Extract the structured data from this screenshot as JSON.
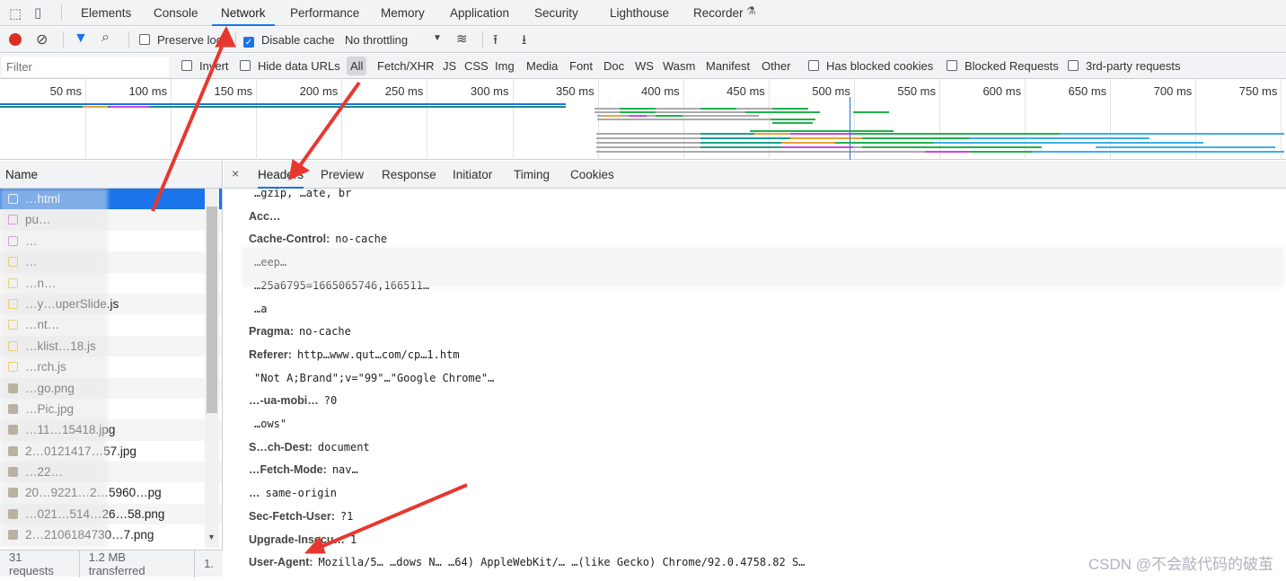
{
  "devtools_tabs": [
    "Elements",
    "Console",
    "Network",
    "Performance",
    "Memory",
    "Application",
    "Security",
    "Lighthouse",
    "Recorder"
  ],
  "active_tab": "Network",
  "toolbar": {
    "preserve_log": "Preserve log",
    "disable_cache": "Disable cache",
    "disable_cache_checked": true,
    "throttling": "No throttling"
  },
  "filterbar": {
    "placeholder": "Filter",
    "invert": "Invert",
    "hide_data_urls": "Hide data URLs",
    "types": [
      "All",
      "Fetch/XHR",
      "JS",
      "CSS",
      "Img",
      "Media",
      "Font",
      "Doc",
      "WS",
      "Wasm",
      "Manifest",
      "Other"
    ],
    "active_type": "All",
    "blocked_cookies": "Has blocked cookies",
    "blocked_requests": "Blocked Requests",
    "third_party": "3rd-party requests"
  },
  "overview": {
    "ticks": [
      "50 ms",
      "100 ms",
      "150 ms",
      "200 ms",
      "250 ms",
      "300 ms",
      "350 ms",
      "400 ms",
      "450 ms",
      "500 ms",
      "550 ms",
      "600 ms",
      "650 ms",
      "700 ms",
      "750 ms"
    ]
  },
  "requests": {
    "header": "Name",
    "items": [
      {
        "name": "…html",
        "type": "doc"
      },
      {
        "name": "pu…",
        "type": "css"
      },
      {
        "name": "…",
        "type": "css"
      },
      {
        "name": "…",
        "type": "js"
      },
      {
        "name": "…n…",
        "type": "js"
      },
      {
        "name": "…y…uperSlide.js",
        "type": "js"
      },
      {
        "name": "…nt…",
        "type": "js"
      },
      {
        "name": "…klist…18.js",
        "type": "js"
      },
      {
        "name": "…rch.js",
        "type": "js"
      },
      {
        "name": "…go.png",
        "type": "img"
      },
      {
        "name": "…Pic.jpg",
        "type": "img"
      },
      {
        "name": "…11…15418.jpg",
        "type": "img"
      },
      {
        "name": "2…0121417…57.jpg",
        "type": "img"
      },
      {
        "name": "…22…",
        "type": "img"
      },
      {
        "name": "20…9221…2…5960…pg",
        "type": "img"
      },
      {
        "name": "…021…514…26…58.png",
        "type": "img"
      },
      {
        "name": "2…2106184730…7.png",
        "type": "img"
      }
    ]
  },
  "status": {
    "requests": "31 requests",
    "transferred": "1.2 MB transferred",
    "resources": "1."
  },
  "detail_tabs": [
    "Headers",
    "Preview",
    "Response",
    "Initiator",
    "Timing",
    "Cookies"
  ],
  "active_detail_tab": "Headers",
  "headers": [
    {
      "k": "",
      "v": "…gzip, …ate, br"
    },
    {
      "k": "Acc…",
      "v": ""
    },
    {
      "k": "Cache-Control:",
      "v": "no-cache"
    },
    {
      "k": "",
      "v": "…eep…"
    },
    {
      "k": "",
      "v": "…25a6795=1665065746,166511…"
    },
    {
      "k": "",
      "v": "…a"
    },
    {
      "k": "Pragma:",
      "v": "no-cache"
    },
    {
      "k": "Referer:",
      "v": "http…www.qut…com/cp…1.htm"
    },
    {
      "k": "",
      "v": "\"Not A;Brand\";v=\"99\"…\"Google Chrome\"…"
    },
    {
      "k": "…-ua-mobi…",
      "v": "?0"
    },
    {
      "k": "",
      "v": "…ows\""
    },
    {
      "k": "S…ch-Dest:",
      "v": "document"
    },
    {
      "k": "…Fetch-Mode:",
      "v": "nav…"
    },
    {
      "k": "…",
      "v": "same-origin"
    },
    {
      "k": "Sec-Fetch-User:",
      "v": "?1"
    },
    {
      "k": "Upgrade-Insecu…",
      "v": "1"
    },
    {
      "k": "User-Agent:",
      "v": "Mozilla/5… …dows N… …64) AppleWebKit/… …(like Gecko) Chrome/92.0.4758.82 S…"
    }
  ],
  "watermark": "CSDN @不会敲代码的破茧",
  "colors": {
    "accent": "#1a73e8",
    "record": "#d93025",
    "annotation_arrow": "#e8372f"
  }
}
